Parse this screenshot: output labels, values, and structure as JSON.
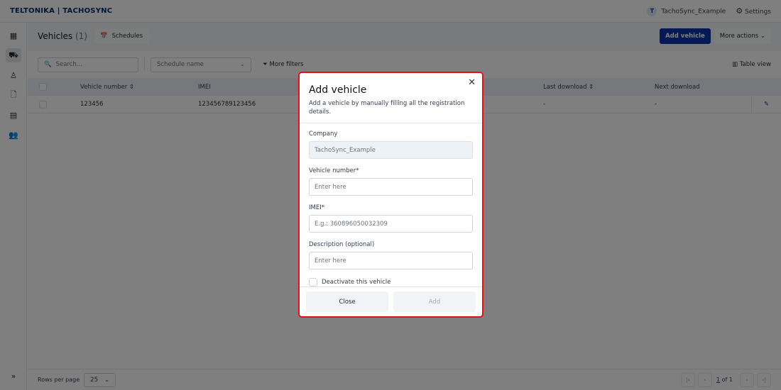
{
  "brand": {
    "logo": "TELTONIKA",
    "product": "TACHOSYNC"
  },
  "topbar": {
    "avatar_initial": "T",
    "company": "TachoSync_Example",
    "settings": "Settings"
  },
  "sidebar": {
    "items": [
      {
        "icon": "dashboard-icon"
      },
      {
        "icon": "truck-icon",
        "active": true
      },
      {
        "icon": "driver-icon"
      },
      {
        "icon": "file-icon"
      },
      {
        "icon": "building-icon"
      },
      {
        "icon": "users-icon"
      }
    ],
    "expand_icon": "double-chevron-right-icon"
  },
  "header": {
    "title": "Vehicles",
    "count": "(1)",
    "schedules": "Schedules",
    "add_vehicle": "Add vehicle",
    "more_actions": "More actions"
  },
  "filters": {
    "search_placeholder": "Search...",
    "schedule_placeholder": "Schedule name",
    "more_filters": "More filters",
    "table_view": "Table view"
  },
  "table": {
    "columns": [
      "Vehicle number",
      "IMEI",
      "Last download",
      "Next download"
    ],
    "rows": [
      {
        "vehicle_number": "123456",
        "imei": "123456789123456",
        "last_download": "-",
        "next_download": "-"
      }
    ]
  },
  "footer": {
    "rows_per_page_label": "Rows per page",
    "rows_per_page": "25",
    "page": "1",
    "of": "of 1"
  },
  "modal": {
    "title": "Add vehicle",
    "description": "Add a vehicle by manually filling all the registration details.",
    "company_label": "Company",
    "company_value": "TachoSync_Example",
    "vehicle_label": "Vehicle number*",
    "vehicle_placeholder": "Enter here",
    "imei_label": "IMEI*",
    "imei_placeholder": "E.g.: 360896050032309",
    "desc_label": "Description (optional)",
    "desc_placeholder": "Enter here",
    "deactivate": "Deactivate this vehicle",
    "close": "Close",
    "add": "Add"
  },
  "colors": {
    "primary": "#0b34a8",
    "highlight": "#e3101a"
  }
}
